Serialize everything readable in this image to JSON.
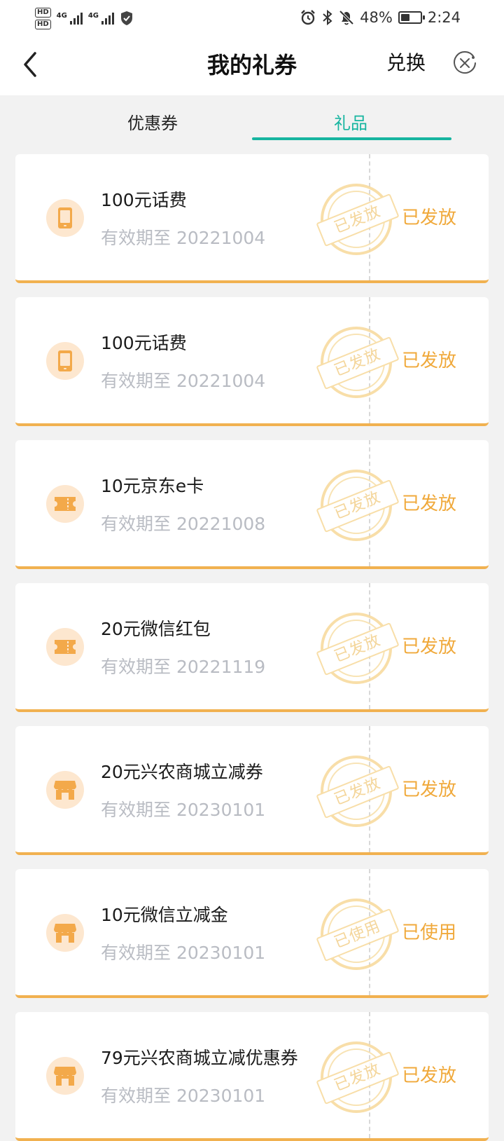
{
  "status_bar": {
    "hd1": "HD",
    "hd2": "HD",
    "net1": "4G",
    "net2": "4G",
    "battery_percent": "48%",
    "battery_level": 0.48,
    "time": "2:24"
  },
  "nav": {
    "title": "我的礼券",
    "exchange_label": "兑换"
  },
  "tabs": {
    "coupon": "优惠券",
    "gift": "礼品",
    "active": "gift",
    "accent_color": "#17b5a0"
  },
  "colors": {
    "status": "#f0a93b",
    "card_border": "#f1b150",
    "icon_bg": "#fde7cf",
    "icon_fg": "#f3a94a"
  },
  "gifts": [
    {
      "icon": "phone-icon",
      "name": "100元话费",
      "date": "有效期至 20221004",
      "stamp": "已发放",
      "status": "已发放"
    },
    {
      "icon": "phone-icon",
      "name": "100元话费",
      "date": "有效期至 20221004",
      "stamp": "已发放",
      "status": "已发放"
    },
    {
      "icon": "ticket-icon",
      "name": "10元京东e卡",
      "date": "有效期至 20221008",
      "stamp": "已发放",
      "status": "已发放"
    },
    {
      "icon": "ticket-icon",
      "name": "20元微信红包",
      "date": "有效期至 20221119",
      "stamp": "已发放",
      "status": "已发放"
    },
    {
      "icon": "store-icon",
      "name": "20元兴农商城立减券",
      "date": "有效期至 20230101",
      "stamp": "已发放",
      "status": "已发放"
    },
    {
      "icon": "store-icon",
      "name": "10元微信立减金",
      "date": "有效期至 20230101",
      "stamp": "已使用",
      "status": "已使用"
    },
    {
      "icon": "store-icon",
      "name": "79元兴农商城立减优惠券",
      "date": "有效期至 20230101",
      "stamp": "已发放",
      "status": "已发放"
    }
  ]
}
